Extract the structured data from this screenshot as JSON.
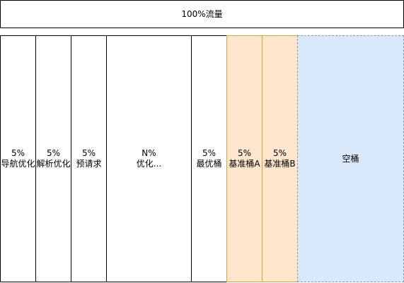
{
  "total": {
    "label": "100%流量"
  },
  "buckets": [
    {
      "pct": "5%",
      "name": "导航优化"
    },
    {
      "pct": "5%",
      "name": "解析优化"
    },
    {
      "pct": "5%",
      "name": "预请求"
    },
    {
      "pct": "N%",
      "name": "优化..."
    },
    {
      "pct": "5%",
      "name": "最优桶"
    },
    {
      "pct": "5%",
      "name": "基准桶A"
    },
    {
      "pct": "5%",
      "name": "基准桶B"
    },
    {
      "name": "空桶"
    }
  ],
  "colors": {
    "baseline_fill": "#ffe6cc",
    "baseline_border": "#d6a43a",
    "empty_fill": "#dae8fc",
    "empty_border": "#8a97ab"
  }
}
